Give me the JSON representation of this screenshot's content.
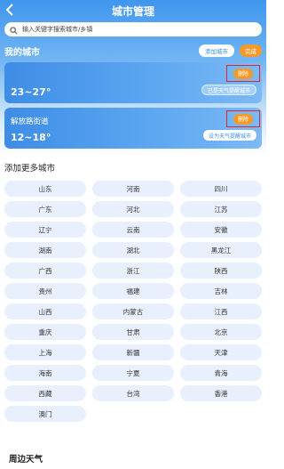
{
  "header": {
    "title": "城市管理"
  },
  "search": {
    "placeholder": "输入关键字搜索城市/乡镇"
  },
  "my_cities": {
    "title": "我的城市",
    "add_label": "添加城市",
    "done_label": "完成",
    "delete_label": "删除",
    "cards": [
      {
        "name": "",
        "temp": "23~27°",
        "remind": "已是天气提醒城市"
      },
      {
        "name": "解放路街道",
        "temp": "12~18°",
        "remind": "设为天气提醒城市"
      }
    ]
  },
  "more": {
    "title": "添加更多城市",
    "cities": [
      "山东",
      "河南",
      "四川",
      "广东",
      "河北",
      "江苏",
      "辽宁",
      "云南",
      "安徽",
      "湖南",
      "湖北",
      "黑龙江",
      "广西",
      "浙江",
      "陕西",
      "贵州",
      "福建",
      "吉林",
      "山西",
      "内蒙古",
      "江西",
      "重庆",
      "甘肃",
      "北京",
      "上海",
      "新疆",
      "天津",
      "海南",
      "宁夏",
      "青海",
      "西藏",
      "台湾",
      "香港",
      "澳门"
    ]
  },
  "nearby": {
    "title": "周边天气"
  }
}
